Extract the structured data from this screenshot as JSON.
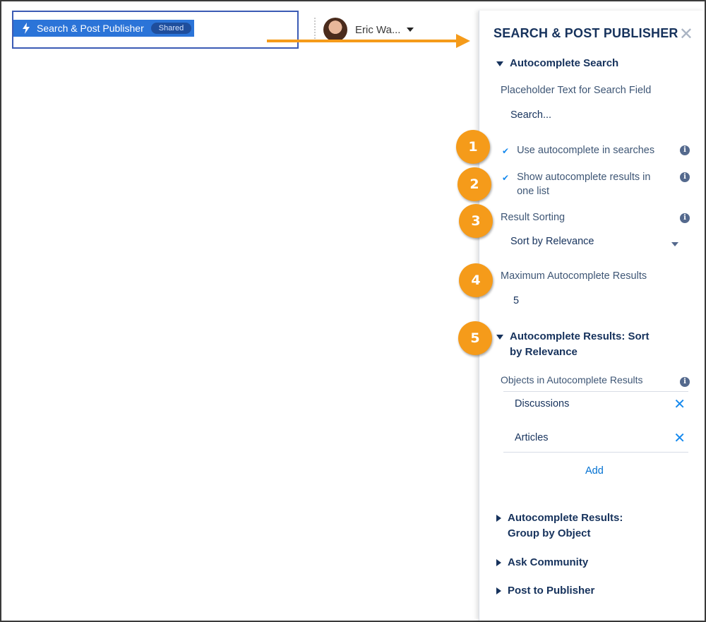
{
  "component_bar": {
    "name": "Search & Post Publisher",
    "badge": "Shared"
  },
  "user": {
    "name": "Eric Wa..."
  },
  "panel": {
    "title": "SEARCH & POST PUBLISHER",
    "autocomplete_search": {
      "header": "Autocomplete Search",
      "placeholder_label": "Placeholder Text for Search Field",
      "placeholder_value": "Search...",
      "use_autocomplete": "Use autocomplete in searches",
      "show_one_list_line1": "Show autocomplete results in",
      "show_one_list_line2": "one list",
      "result_sorting_label": "Result Sorting",
      "result_sorting_value": "Sort by Relevance",
      "max_results_label": "Maximum Autocomplete Results",
      "max_results_value": "5"
    },
    "sort_by_relevance": {
      "header_line1": "Autocomplete Results: Sort",
      "header_line2": "by Relevance",
      "objects_label": "Objects in Autocomplete Results",
      "objects": [
        "Discussions",
        "Articles"
      ],
      "add_label": "Add"
    },
    "group_by_object": {
      "header_line1": "Autocomplete Results:",
      "header_line2": "Group by Object"
    },
    "ask_community": {
      "header": "Ask Community"
    },
    "post_to_publisher": {
      "header": "Post to Publisher"
    }
  },
  "callouts": [
    "1",
    "2",
    "3",
    "4",
    "5"
  ],
  "colors": {
    "accent_orange": "#f59b1a",
    "brand_blue": "#2b74d8",
    "link_blue": "#0070d2",
    "navy": "#16325c"
  },
  "icons": {
    "bolt": "lightning-bolt-icon",
    "close": "close-icon",
    "info": "info-icon",
    "check": "checkmark-icon",
    "remove": "remove-icon"
  }
}
